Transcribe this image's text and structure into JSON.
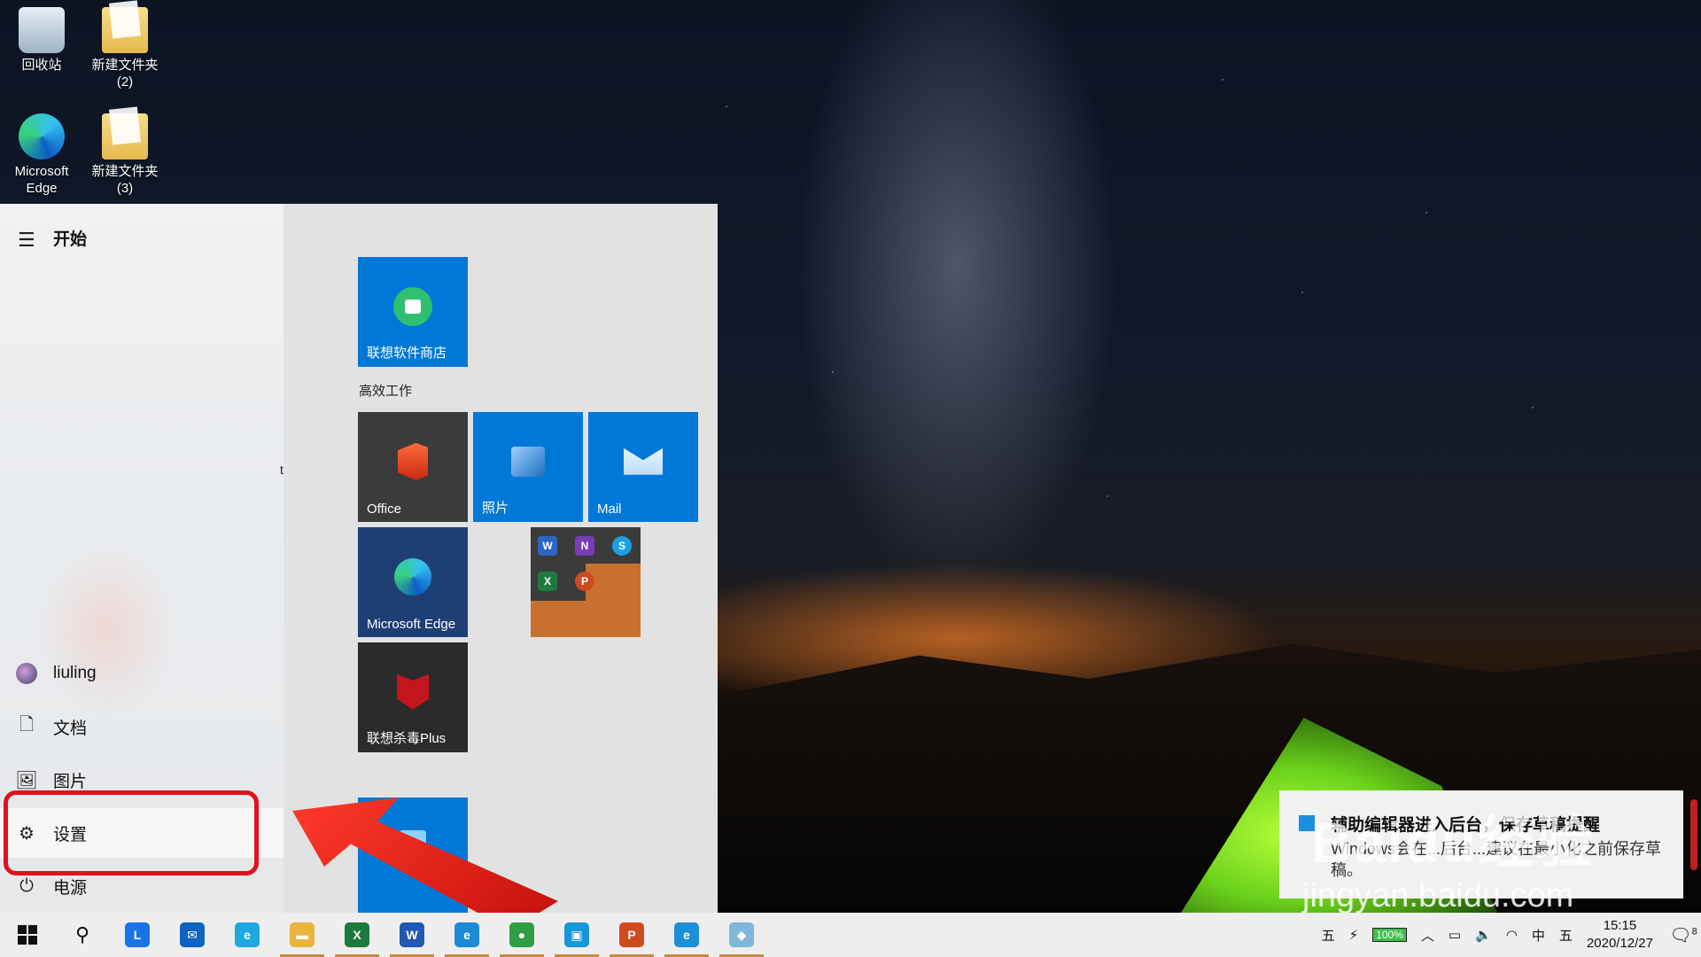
{
  "desktop": {
    "icons": [
      {
        "label": "回收站",
        "icon": "recycle-bin-icon"
      },
      {
        "label": "新建文件夹\n(2)",
        "icon": "folder-icon"
      },
      {
        "label": "Microsoft\nEdge",
        "icon": "edge-icon"
      },
      {
        "label": "新建文件夹\n(3)",
        "icon": "folder-icon"
      }
    ]
  },
  "start_menu": {
    "title": "开始",
    "left_items": [
      {
        "label": "liuling",
        "icon": "user-avatar"
      },
      {
        "label": "文档",
        "icon": "document-icon"
      },
      {
        "label": "图片",
        "icon": "pictures-icon"
      },
      {
        "label": "设置",
        "icon": "gear-icon",
        "selected": true
      },
      {
        "label": "电源",
        "icon": "power-icon"
      }
    ],
    "fragment_text": "te",
    "group_label": "高效工作",
    "tiles": {
      "lenovo_store": {
        "label": "联想软件商店",
        "color": "#0078d7"
      },
      "office": {
        "label": "Office",
        "color": "#3b3b3b"
      },
      "photos": {
        "label": "照片",
        "color": "#0078d7"
      },
      "mail": {
        "label": "Mail",
        "color": "#0078d7"
      },
      "edge": {
        "label": "Microsoft Edge",
        "color": "#1f3f74"
      },
      "office_apps": {
        "color_top": "#3b3b3b",
        "color_bottom": "#c8702e",
        "apps": [
          "W",
          "N",
          "S",
          "X",
          "P"
        ]
      },
      "mcafee": {
        "label": "联想杀毒Plus",
        "color": "#2b2b2b"
      }
    }
  },
  "toast": {
    "title": "辅助编辑器进入后台，保存草稿提醒",
    "body": "Windows会在...后台...建议在最小化之前保存草稿。"
  },
  "watermark": {
    "line1": "Baidu经验",
    "line2": "jingyan.baidu.com"
  },
  "taskbar": {
    "apps": [
      {
        "name": "lenovo-l-icon",
        "color": "#1a73e8",
        "text": "L",
        "running": false
      },
      {
        "name": "mail-app-icon",
        "color": "#0a64c0",
        "text": "✉",
        "running": false
      },
      {
        "name": "browser-e-icon",
        "color": "#1ea7e1",
        "text": "e",
        "running": false
      },
      {
        "name": "file-explorer-icon",
        "color": "#e9b53c",
        "text": "▬",
        "running": true
      },
      {
        "name": "excel-icon",
        "color": "#1d7a3e",
        "text": "X",
        "running": true
      },
      {
        "name": "word-icon",
        "color": "#2358b2",
        "text": "W",
        "running": true
      },
      {
        "name": "edge-taskbar-icon",
        "color": "#1d8ad6",
        "text": "e",
        "running": true
      },
      {
        "name": "chrome-icon",
        "color": "#2f9e44",
        "text": "●",
        "running": true
      },
      {
        "name": "screen-app-icon",
        "color": "#1698d8",
        "text": "▣",
        "running": true
      },
      {
        "name": "powerpoint-icon",
        "color": "#d04a1f",
        "text": "P",
        "running": true
      },
      {
        "name": "ie-icon",
        "color": "#1c8fd6",
        "text": "e",
        "running": true
      },
      {
        "name": "notes-app-icon",
        "color": "#7fb6d9",
        "text": "◆",
        "running": true
      }
    ],
    "tray": {
      "ime_left": "五",
      "battery": "100%",
      "ime_lang": "中",
      "ime_right": "五",
      "time": "15:15",
      "date": "2020/12/27",
      "notifications": "8"
    }
  }
}
